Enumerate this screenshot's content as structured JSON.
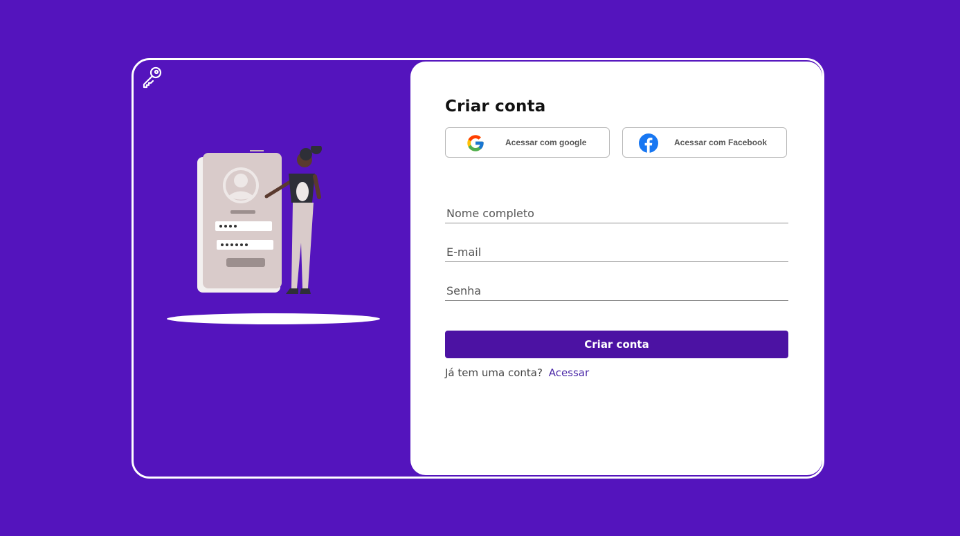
{
  "form": {
    "title": "Criar conta",
    "google_label": "Acessar com google",
    "facebook_label": "Acessar com Facebook",
    "name_placeholder": "Nome completo",
    "email_placeholder": "E-mail",
    "password_placeholder": "Senha",
    "submit_label": "Criar conta",
    "login_prompt": "Já tem uma conta?",
    "login_link": "Acessar"
  },
  "icons": {
    "logo": "key-icon",
    "google": "google-icon",
    "facebook": "facebook-icon"
  },
  "colors": {
    "background": "#5414bd",
    "primary_button": "#4c12a3",
    "link": "#4c2aa8",
    "facebook_blue": "#1877f2"
  }
}
